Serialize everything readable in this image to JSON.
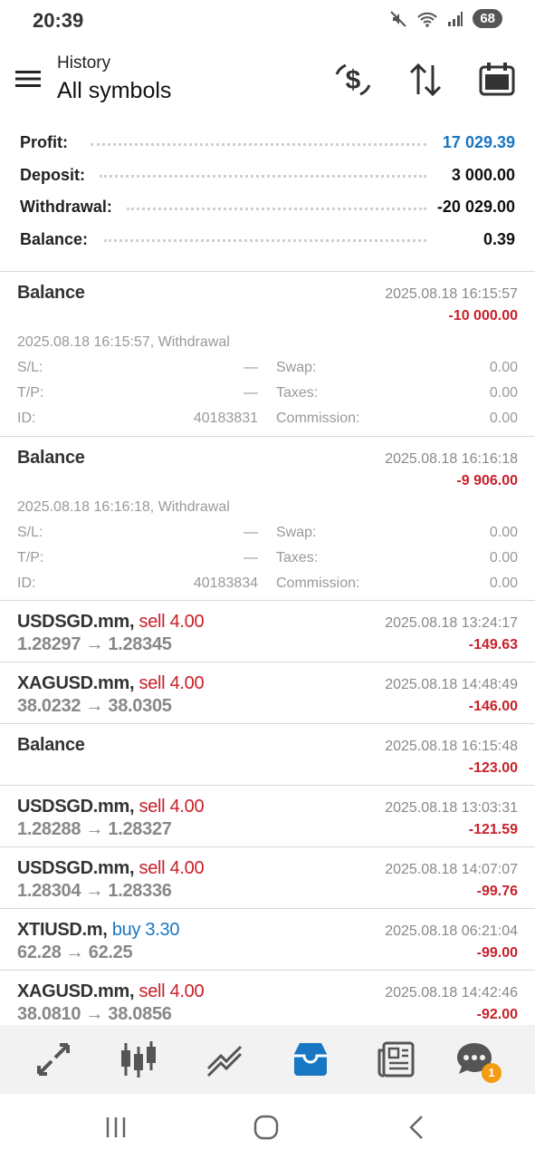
{
  "status": {
    "time": "20:39",
    "battery": "68"
  },
  "header": {
    "subtitle": "History",
    "title": "All symbols"
  },
  "summary": [
    {
      "label": "Profit:",
      "value": "17 029.39",
      "color": "#1976c2"
    },
    {
      "label": "Deposit:",
      "value": "3 000.00",
      "color": "#111111"
    },
    {
      "label": "Withdrawal:",
      "value": "-20 029.00",
      "color": "#111111"
    },
    {
      "label": "Balance:",
      "value": "0.39",
      "color": "#111111"
    }
  ],
  "balance_details": [
    {
      "title": "Balance",
      "time": "2025.08.18 16:15:57",
      "profit": "-10 000.00",
      "detail": "2025.08.18 16:15:57, Withdrawal",
      "sl_label": "S/L:",
      "sl": "—",
      "swap_label": "Swap:",
      "swap": "0.00",
      "tp_label": "T/P:",
      "tp": "—",
      "taxes_label": "Taxes:",
      "taxes": "0.00",
      "id_label": "ID:",
      "id": "40183831",
      "commission_label": "Commission:",
      "commission": "0.00"
    },
    {
      "title": "Balance",
      "time": "2025.08.18 16:16:18",
      "profit": "-9 906.00",
      "detail": "2025.08.18 16:16:18, Withdrawal",
      "sl_label": "S/L:",
      "sl": "—",
      "swap_label": "Swap:",
      "swap": "0.00",
      "tp_label": "T/P:",
      "tp": "—",
      "taxes_label": "Taxes:",
      "taxes": "0.00",
      "id_label": "ID:",
      "id": "40183834",
      "commission_label": "Commission:",
      "commission": "0.00"
    }
  ],
  "deals": [
    {
      "symbol": "USDSGD.mm,",
      "side": "sell 4.00",
      "type": "sell",
      "prices": "1.28297 → 1.28345",
      "time": "2025.08.18 13:24:17",
      "profit": "-149.63"
    },
    {
      "symbol": "XAGUSD.mm,",
      "side": "sell 4.00",
      "type": "sell",
      "prices": "38.0232 → 38.0305",
      "time": "2025.08.18 14:48:49",
      "profit": "-146.00"
    },
    {
      "symbol": "Balance",
      "side": "",
      "type": "balance",
      "prices": "",
      "time": "2025.08.18 16:15:48",
      "profit": "-123.00"
    },
    {
      "symbol": "USDSGD.mm,",
      "side": "sell 4.00",
      "type": "sell",
      "prices": "1.28288 → 1.28327",
      "time": "2025.08.18 13:03:31",
      "profit": "-121.59"
    },
    {
      "symbol": "USDSGD.mm,",
      "side": "sell 4.00",
      "type": "sell",
      "prices": "1.28304 → 1.28336",
      "time": "2025.08.18 14:07:07",
      "profit": "-99.76"
    },
    {
      "symbol": "XTIUSD.m,",
      "side": "buy 3.30",
      "type": "buy",
      "prices": "62.28 → 62.25",
      "time": "2025.08.18 06:21:04",
      "profit": "-99.00"
    },
    {
      "symbol": "XAGUSD.mm,",
      "side": "sell 4.00",
      "type": "sell",
      "prices": "38.0810 → 38.0856",
      "time": "2025.08.18 14:42:46",
      "profit": "-92.00"
    }
  ],
  "bottom_nav": {
    "items": [
      "quotes-icon",
      "chart-icon",
      "trade-icon",
      "history-icon",
      "news-icon",
      "chat-icon"
    ],
    "active": "history-icon",
    "chat_badge": "1"
  },
  "colors": {
    "accent": "#1976c2",
    "loss": "#c8202a",
    "muted": "#888888"
  }
}
